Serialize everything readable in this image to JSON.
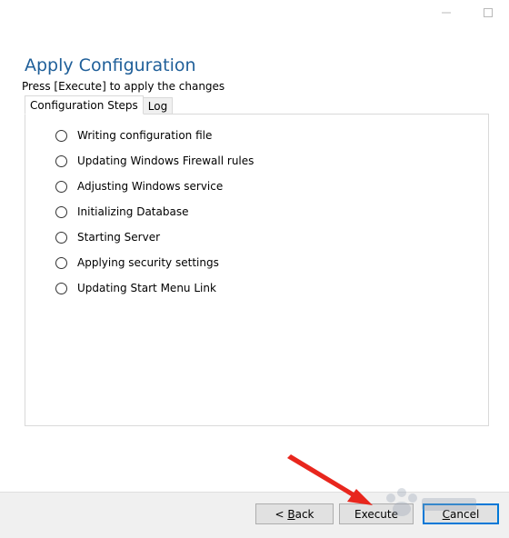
{
  "window": {
    "controls": [
      "minimize-icon",
      "maximize-icon"
    ]
  },
  "header": {
    "title": "Apply Configuration",
    "subtitle": "Press [Execute] to apply the changes"
  },
  "tabs": [
    {
      "label": "Configuration Steps",
      "active": true
    },
    {
      "label": "Log",
      "active": false
    }
  ],
  "steps": [
    {
      "label": "Writing configuration file",
      "checked": false
    },
    {
      "label": "Updating Windows Firewall rules",
      "checked": false
    },
    {
      "label": "Adjusting Windows service",
      "checked": false
    },
    {
      "label": "Initializing Database",
      "checked": false
    },
    {
      "label": "Starting Server",
      "checked": false
    },
    {
      "label": "Applying security settings",
      "checked": false
    },
    {
      "label": "Updating Start Menu Link",
      "checked": false
    }
  ],
  "footer": {
    "back_prefix": "< ",
    "back_mnemonic": "B",
    "back_rest": "ack",
    "execute_label": "Execute",
    "cancel_mnemonic": "C",
    "cancel_rest": "ancel"
  },
  "annotation": {
    "arrow_color": "#e8261d",
    "target": "execute-button"
  },
  "colors": {
    "title": "#1f5f99",
    "focus_border": "#0078d7",
    "footer_bg": "#f0f0f0"
  }
}
